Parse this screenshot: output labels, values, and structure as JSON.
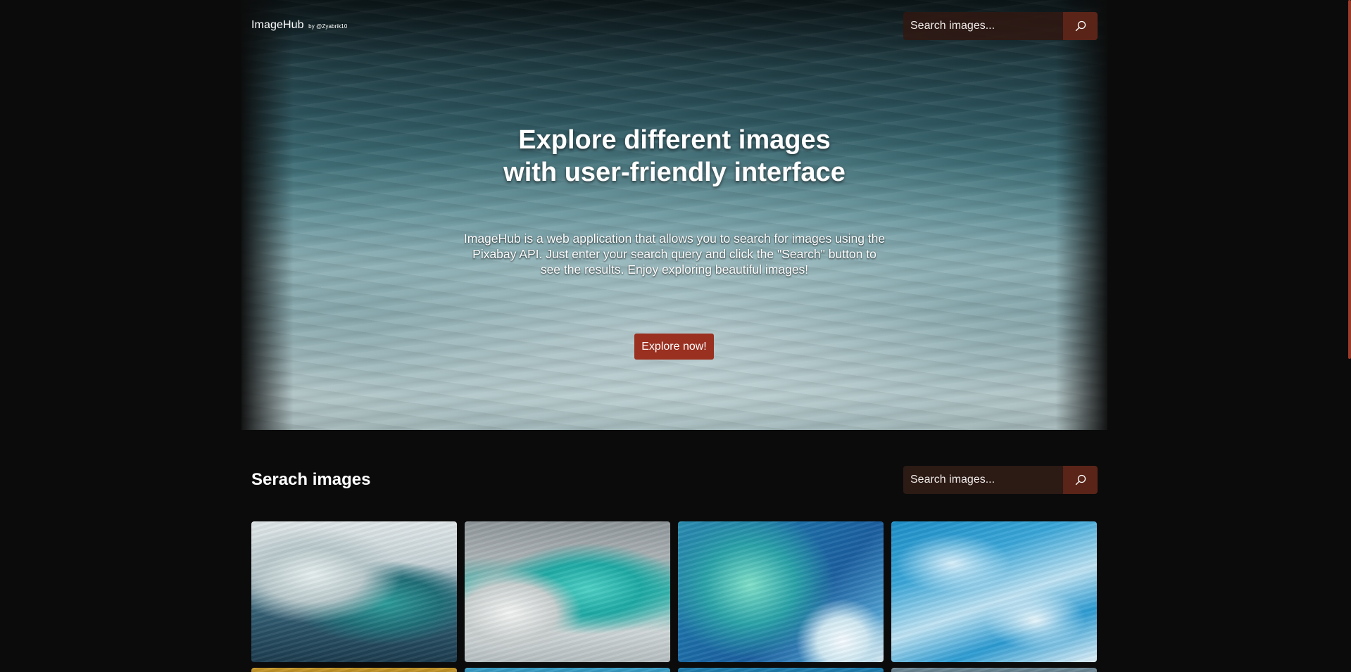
{
  "app": {
    "name": "ImageHub",
    "byline": "by @Zyabrik10"
  },
  "header_search": {
    "placeholder": "Search images...",
    "button_icon": "search-icon"
  },
  "hero": {
    "title": "Explore different images\nwith user-friendly interface",
    "description": "ImageHub is a web application that allows you to search for images using the Pixabay API. Just enter your search query and click the \"Search\" button to see the results. Enjoy exploring beautiful images!",
    "cta_label": "Explore now!"
  },
  "search_section": {
    "title": "Serach images",
    "placeholder": "Search images...",
    "button_icon": "search-icon"
  },
  "gallery": {
    "images": [
      {
        "alt_semantic": "wave-image"
      },
      {
        "alt_semantic": "wave-image"
      },
      {
        "alt_semantic": "wave-image"
      },
      {
        "alt_semantic": "wave-image"
      },
      {
        "alt_semantic": "wave-image"
      },
      {
        "alt_semantic": "wave-image"
      },
      {
        "alt_semantic": "wave-image"
      },
      {
        "alt_semantic": "wave-image"
      }
    ]
  },
  "colors": {
    "background": "#0b0b0b",
    "accent": "#9a3020",
    "search_button": "#5a2418",
    "search_input": "#2c1a15"
  }
}
